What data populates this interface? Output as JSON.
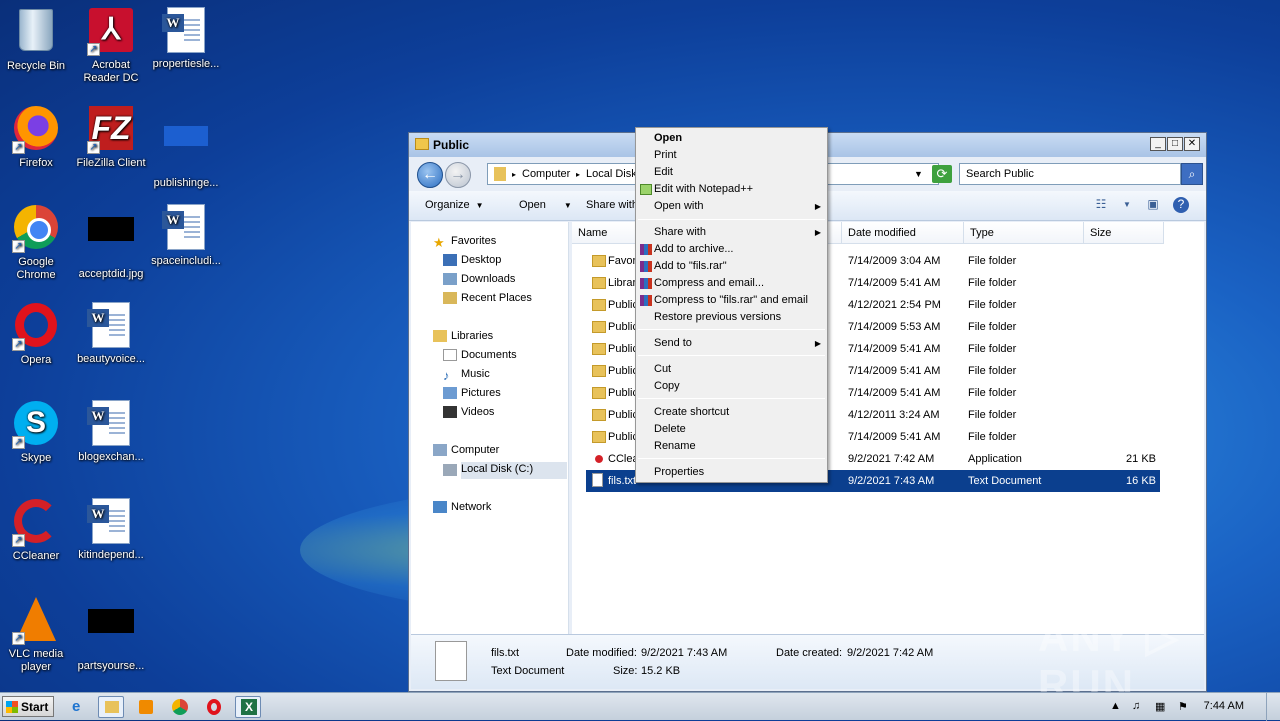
{
  "desktop": {
    "icons": [
      {
        "label": "Recycle Bin",
        "icon": "recycle-bin-icon"
      },
      {
        "label": "Acrobat Reader DC",
        "icon": "acrobat-icon"
      },
      {
        "label": "propertiesle...",
        "icon": "word-doc-icon"
      },
      {
        "label": "Firefox",
        "icon": "firefox-icon"
      },
      {
        "label": "FileZilla Client",
        "icon": "filezilla-icon"
      },
      {
        "label": "publishinge...",
        "icon": "file-icon"
      },
      {
        "label": "Google Chrome",
        "icon": "chrome-icon"
      },
      {
        "label": "acceptdid.jpg",
        "icon": "image-file-icon"
      },
      {
        "label": "spaceincludi...",
        "icon": "word-doc-icon"
      },
      {
        "label": "Opera",
        "icon": "opera-icon"
      },
      {
        "label": "beautyvoice...",
        "icon": "word-doc-icon"
      },
      {
        "label": "Skype",
        "icon": "skype-icon"
      },
      {
        "label": "blogexchan...",
        "icon": "word-doc-icon"
      },
      {
        "label": "CCleaner",
        "icon": "ccleaner-icon"
      },
      {
        "label": "kitindepend...",
        "icon": "word-doc-icon"
      },
      {
        "label": "VLC media player",
        "icon": "vlc-icon"
      },
      {
        "label": "partsyourse...",
        "icon": "image-file-icon"
      }
    ]
  },
  "window": {
    "title": "Public",
    "controls": {
      "minimize": "_",
      "maximize": "□",
      "close": "✕"
    },
    "address": {
      "crumbs": [
        "Computer",
        "Local Disk"
      ],
      "separator": "▸"
    },
    "search_placeholder": "Search Public",
    "toolbar": {
      "organize": "Organize",
      "open": "Open",
      "share_with": "Share with"
    },
    "nav": {
      "favorites": "Favorites",
      "desktop": "Desktop",
      "downloads": "Downloads",
      "recent_places": "Recent Places",
      "libraries": "Libraries",
      "documents": "Documents",
      "music": "Music",
      "pictures": "Pictures",
      "videos": "Videos",
      "computer": "Computer",
      "local_disk": "Local Disk (C:)",
      "network": "Network"
    },
    "columns": {
      "name": "Name",
      "date": "Date modified",
      "type": "Type",
      "size": "Size"
    },
    "rows": [
      {
        "name": "Favor",
        "date": "7/14/2009 3:04 AM",
        "type": "File folder",
        "size": ""
      },
      {
        "name": "Librar",
        "date": "7/14/2009 5:41 AM",
        "type": "File folder",
        "size": ""
      },
      {
        "name": "Public",
        "date": "4/12/2021 2:54 PM",
        "type": "File folder",
        "size": ""
      },
      {
        "name": "Public",
        "date": "7/14/2009 5:53 AM",
        "type": "File folder",
        "size": ""
      },
      {
        "name": "Public",
        "date": "7/14/2009 5:41 AM",
        "type": "File folder",
        "size": ""
      },
      {
        "name": "Public",
        "date": "7/14/2009 5:41 AM",
        "type": "File folder",
        "size": ""
      },
      {
        "name": "Public",
        "date": "7/14/2009 5:41 AM",
        "type": "File folder",
        "size": ""
      },
      {
        "name": "Public",
        "date": "4/12/2011 3:24 AM",
        "type": "File folder",
        "size": ""
      },
      {
        "name": "Public",
        "date": "7/14/2009 5:41 AM",
        "type": "File folder",
        "size": ""
      },
      {
        "name": "CClea",
        "date": "9/2/2021 7:42 AM",
        "type": "Application",
        "size": "21 KB"
      },
      {
        "name": "fils.txt",
        "date": "9/2/2021 7:43 AM",
        "type": "Text Document",
        "size": "16 KB"
      }
    ],
    "details": {
      "filename": "fils.txt",
      "filetype": "Text Document",
      "modified_label": "Date modified:",
      "modified": "9/2/2021 7:43 AM",
      "size_label": "Size:",
      "size": "15.2 KB",
      "created_label": "Date created:",
      "created": "9/2/2021 7:42 AM"
    }
  },
  "context_menu": {
    "open": "Open",
    "print": "Print",
    "edit": "Edit",
    "edit_npp": "Edit with Notepad++",
    "open_with": "Open with",
    "share_with": "Share with",
    "add_archive": "Add to archive...",
    "add_rar": "Add to \"fils.rar\"",
    "compress_email": "Compress and email...",
    "compress_rar_email": "Compress to \"fils.rar\" and email",
    "restore": "Restore previous versions",
    "send_to": "Send to",
    "cut": "Cut",
    "copy": "Copy",
    "create_shortcut": "Create shortcut",
    "delete": "Delete",
    "rename": "Rename",
    "properties": "Properties"
  },
  "watermark": "ANY ▷ RUN",
  "taskbar": {
    "start": "Start",
    "clock": "7:44 AM"
  },
  "colors": {
    "selection": "#0b3f8e",
    "menu_bg": "#f0f0f0",
    "desktop": "#1a62c4"
  }
}
